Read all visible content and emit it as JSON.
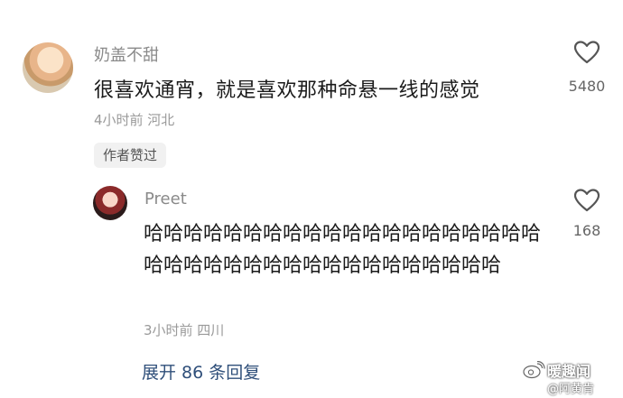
{
  "comments": [
    {
      "username": "奶盖不甜",
      "text": "很喜欢通宵，就是喜欢那种命悬一线的感觉",
      "meta": "4小时前 河北",
      "badge": "作者赞过",
      "likes": "5480",
      "icons": {
        "avatar": "avatar",
        "like": "heart-outline-icon"
      }
    },
    {
      "username": "Preet",
      "text": "哈哈哈哈哈哈哈哈哈哈哈哈哈哈哈哈哈哈哈哈哈哈哈哈哈哈哈哈哈哈哈哈哈哈哈哈哈哈",
      "meta": "3小时前 四川",
      "likes": "168",
      "icons": {
        "avatar": "avatar",
        "like": "heart-outline-icon"
      }
    }
  ],
  "replies": {
    "expand_label": "展开 86 条回复"
  },
  "watermark": {
    "brand": "暖趣闻",
    "user": "@阿黄肯"
  },
  "colors": {
    "link": "#2f4f7a",
    "muted": "#9a9a9a",
    "text": "#1a1a1a"
  }
}
